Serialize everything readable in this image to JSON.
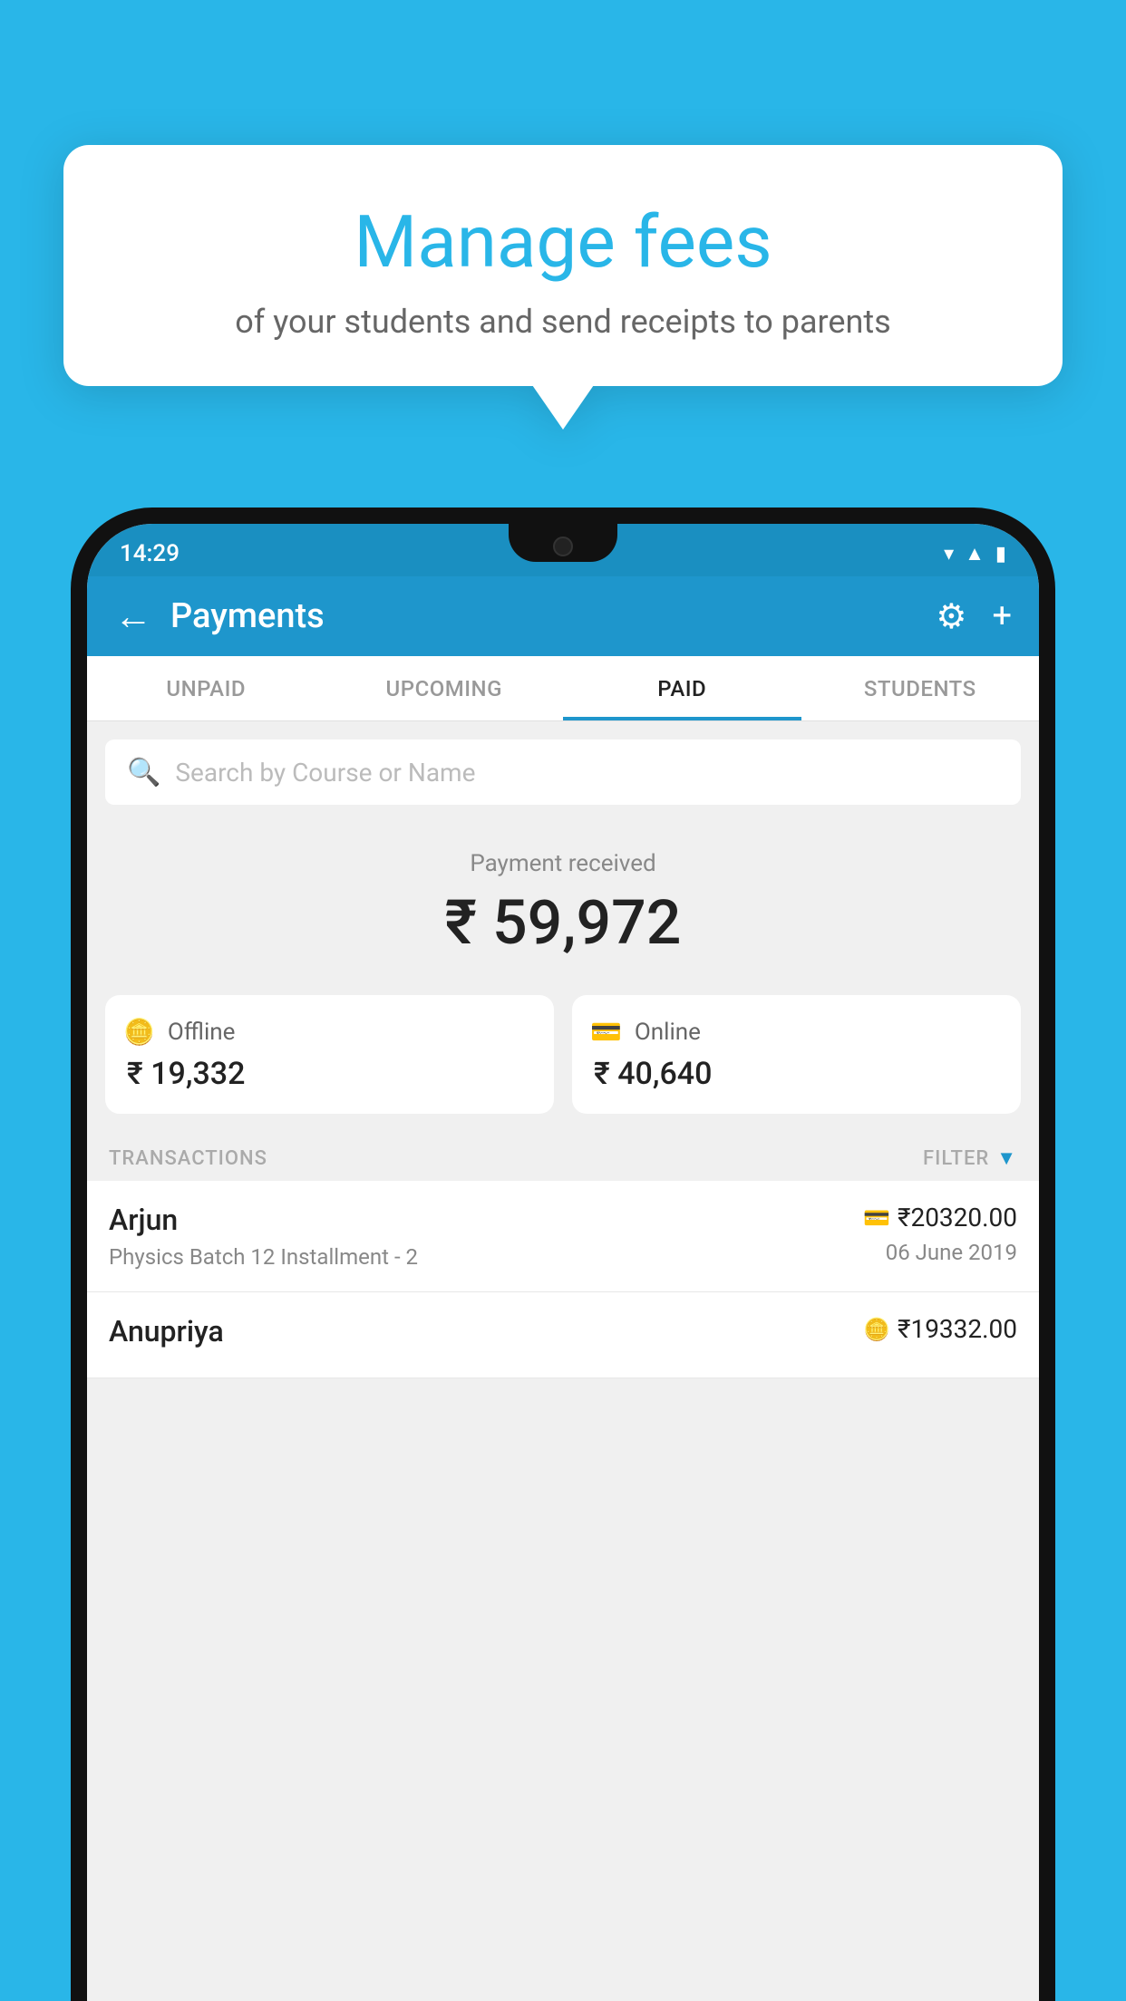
{
  "background_color": "#29b6e8",
  "speech_bubble": {
    "title": "Manage fees",
    "subtitle": "of your students and send receipts to parents"
  },
  "status_bar": {
    "time": "14:29",
    "icons": [
      "wifi",
      "signal",
      "battery"
    ]
  },
  "header": {
    "title": "Payments",
    "back_label": "←",
    "settings_icon": "⚙",
    "add_icon": "+"
  },
  "tabs": [
    {
      "label": "UNPAID",
      "active": false
    },
    {
      "label": "UPCOMING",
      "active": false
    },
    {
      "label": "PAID",
      "active": true
    },
    {
      "label": "STUDENTS",
      "active": false
    }
  ],
  "search": {
    "placeholder": "Search by Course or Name"
  },
  "payment_received": {
    "label": "Payment received",
    "amount": "₹ 59,972"
  },
  "payment_cards": [
    {
      "type": "Offline",
      "amount": "₹ 19,332",
      "icon": "cash"
    },
    {
      "type": "Online",
      "amount": "₹ 40,640",
      "icon": "card"
    }
  ],
  "transactions_section": {
    "label": "TRANSACTIONS",
    "filter_label": "FILTER"
  },
  "transactions": [
    {
      "name": "Arjun",
      "description": "Physics Batch 12 Installment - 2",
      "amount": "₹20320.00",
      "date": "06 June 2019",
      "payment_type": "card"
    },
    {
      "name": "Anupriya",
      "description": "",
      "amount": "₹19332.00",
      "date": "",
      "payment_type": "cash"
    }
  ]
}
